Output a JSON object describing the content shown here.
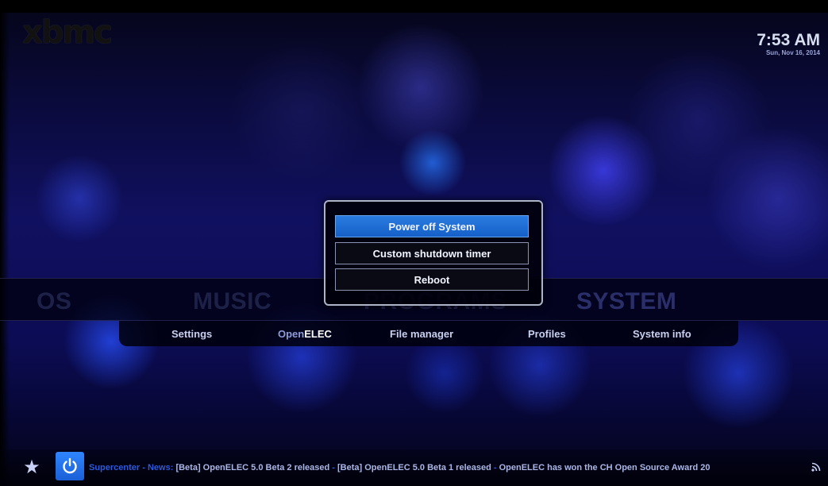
{
  "header": {
    "logo_text": "xbmc",
    "time": "7:53 AM",
    "date": "Sun, Nov 16, 2014"
  },
  "main_menu": {
    "items": [
      {
        "label": "OS"
      },
      {
        "label": "MUSIC"
      },
      {
        "label": "PROGRAMS"
      },
      {
        "label": "SYSTEM"
      }
    ],
    "selected": "SYSTEM"
  },
  "submenu": {
    "items": [
      {
        "label": "Settings"
      },
      {
        "prefix": "Open",
        "highlight": "ELEC"
      },
      {
        "label": "File manager"
      },
      {
        "label": "Profiles"
      },
      {
        "label": "System info"
      }
    ]
  },
  "shutdown_dialog": {
    "options": [
      {
        "label": "Power off System",
        "focused": true
      },
      {
        "label": "Custom shutdown timer",
        "focused": false
      },
      {
        "label": "Reboot",
        "focused": false
      }
    ]
  },
  "footer": {
    "favourites_icon": "star-icon",
    "power_icon": "power-icon",
    "rss_icon": "rss-icon",
    "ticker_source": "Supercenter - News:",
    "ticker_items": [
      "[Beta] OpenELEC 5.0 Beta 2 released",
      "[Beta] OpenELEC 5.0 Beta 1 released",
      "OpenELEC has won the CH Open Source Award 20"
    ],
    "ticker_separator": " - "
  },
  "colors": {
    "accent": "#1f6fe0",
    "background": "#0c0c55"
  }
}
